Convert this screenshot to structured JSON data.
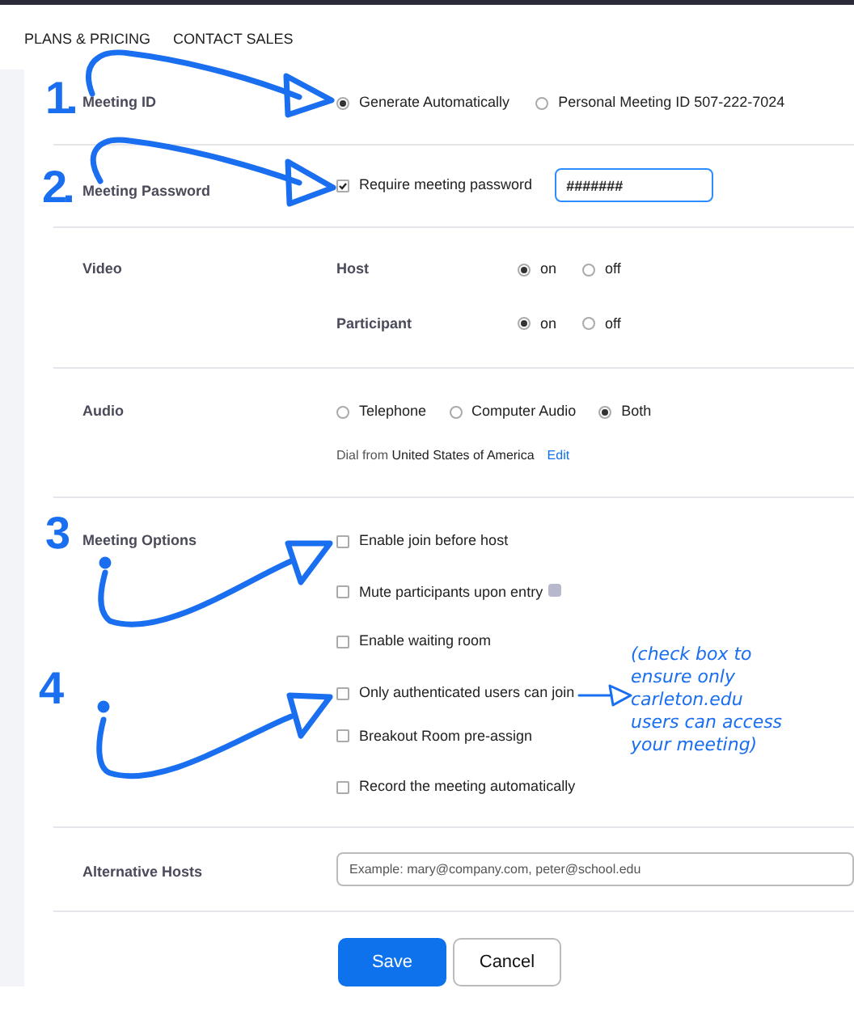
{
  "nav": [
    "PLANS & PRICING",
    "CONTACT SALES"
  ],
  "sections": [
    {
      "kind": "radio",
      "label": "Meeting ID",
      "options": [
        {
          "label": "Generate Automatically",
          "selected": true
        },
        {
          "label": "Personal Meeting ID 507-222-7024",
          "selected": false
        }
      ]
    },
    {
      "kind": "password",
      "label": "Meeting Password",
      "checkbox": {
        "label": "Require meeting password",
        "checked": true
      },
      "value": "#######"
    },
    {
      "kind": "video",
      "label": "Video",
      "rows": [
        {
          "label": "Host",
          "options": [
            {
              "label": "on",
              "selected": true
            },
            {
              "label": "off",
              "selected": false
            }
          ]
        },
        {
          "label": "Participant",
          "options": [
            {
              "label": "on",
              "selected": true
            },
            {
              "label": "off",
              "selected": false
            }
          ]
        }
      ]
    },
    {
      "kind": "audio",
      "label": "Audio",
      "options": [
        {
          "label": "Telephone",
          "selected": false
        },
        {
          "label": "Computer Audio",
          "selected": false
        },
        {
          "label": "Both",
          "selected": true
        }
      ],
      "dial_prefix": "Dial from",
      "dial_country": "United States of America",
      "link": "Edit"
    },
    {
      "kind": "checklist",
      "label": "Meeting Options",
      "items": [
        {
          "label": "Enable join before host",
          "checked": false
        },
        {
          "label": "Mute participants upon entry",
          "checked": false,
          "info": true
        },
        {
          "label": "Enable waiting room",
          "checked": false
        },
        {
          "label": "Only authenticated users can join",
          "checked": false
        },
        {
          "label": "Breakout Room pre-assign",
          "checked": false
        },
        {
          "label": "Record the meeting automatically",
          "checked": false
        }
      ]
    },
    {
      "kind": "text",
      "label": "Alternative Hosts",
      "placeholder": "Example: mary@company.com, peter@school.edu"
    }
  ],
  "buttons": [
    {
      "label": "Save",
      "kind": "primary"
    },
    {
      "label": "Cancel",
      "kind": "secondary"
    }
  ],
  "annotations": {
    "numbers": [
      "1.",
      "2.",
      "3",
      "4"
    ],
    "note_lines": [
      "(check box to",
      "ensure only",
      "carleton.edu",
      "users can access",
      "your meeting)"
    ]
  }
}
